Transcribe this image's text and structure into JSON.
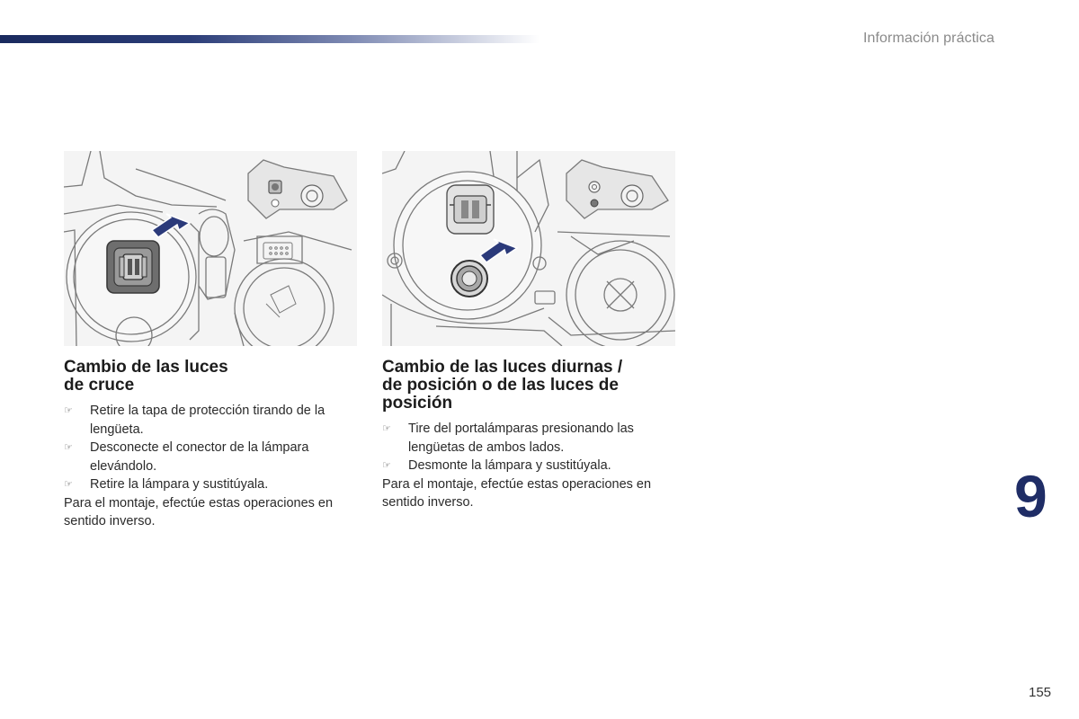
{
  "header": {
    "section": "Información práctica"
  },
  "left": {
    "title_lines": [
      "Cambio de las luces",
      "de cruce"
    ],
    "steps": [
      {
        "bullet": "☞",
        "text": "Retire la tapa de protección tirando de la lengüeta."
      },
      {
        "bullet": "☞",
        "text": "Desconecte el conector de la lámpara elevándolo."
      },
      {
        "bullet": "☞",
        "text": "Retire la lámpara y sustitúyala."
      }
    ],
    "note": "Para el montaje, efectúe estas operaciones en sentido inverso."
  },
  "right": {
    "title_lines": [
      "Cambio de las luces diurnas /",
      "de posición o de las luces de",
      "posición"
    ],
    "steps": [
      {
        "bullet": "☞",
        "text": "Tire del portalámparas presionando las lengüetas de ambos lados."
      },
      {
        "bullet": "☞",
        "text": "Desmonte la lámpara y sustitúyala."
      }
    ],
    "note": "Para el montaje, efectúe estas operaciones en sentido inverso."
  },
  "chapter": "9",
  "page_number": "155",
  "colors": {
    "accent": "#1f2d66",
    "arrow": "#2b3a7a"
  }
}
